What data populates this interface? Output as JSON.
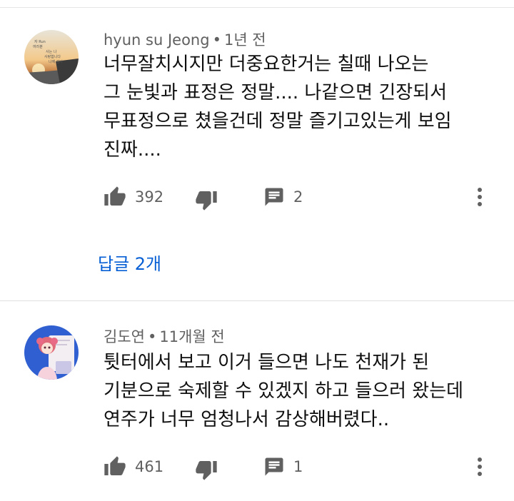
{
  "comments": [
    {
      "author": "hyun su Jeong",
      "time": "1년 전",
      "lines": [
        "너무잘치시지만 더중요한거는 칠때 나오는",
        "그 눈빛과 표정은 정말.... 나같으면 긴장되서",
        "무표정으로 쳤을건데 정말 즐기고있는게 보임",
        "진짜...."
      ],
      "likes": "392",
      "replies": "2",
      "replies_link": "답글 2개",
      "avatar": "sunset-handwriting-avatar",
      "avatar_caption": [
        "자 Run",
        "여러분",
        "사는 나",
        "사랑합니다",
        "나에 감사"
      ]
    },
    {
      "author": "김도연",
      "time": "11개월 전",
      "lines": [
        "튓터에서 보고 이거 들으면 나도 천재가 된",
        "기분으로 숙제할 수 있겠지 하고 들으러 왔는데",
        "연주가 너무 엄청나서 감상해버렸다.."
      ],
      "likes": "461",
      "replies": "1",
      "avatar": "anime-character-avatar"
    }
  ],
  "icons": {
    "like": "thumb-up-icon",
    "dislike": "thumb-down-icon",
    "reply": "comment-icon",
    "more": "more-vert-icon"
  },
  "colors": {
    "link": "#065fd4",
    "meta": "#606060",
    "icon": "#606060"
  }
}
